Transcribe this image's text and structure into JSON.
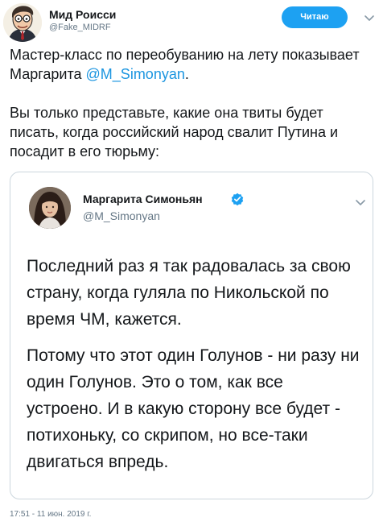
{
  "tweet": {
    "author": {
      "display_name": "Мид Роисси",
      "handle": "@Fake_MIDRF",
      "avatar_icon": "cartoon-avatar-icon"
    },
    "follow_button_label": "Читаю",
    "menu_icon": "chevron-down-icon",
    "text": {
      "paragraph1_prefix": "Мастер-класс по переобуванию на лету показывает Маргарита ",
      "mention": "@M_Simonyan",
      "paragraph1_suffix": ".",
      "paragraph2": "Вы только представьте, какие она твиты будет писать, когда российский народ свалит Путина и посадит в его тюрьму:"
    },
    "timestamp": "17:51 - 11 июн. 2019 г."
  },
  "quoted_tweet": {
    "author": {
      "display_name": "Маргарита Симоньян",
      "handle": "@M_Simonyan",
      "verified_icon": "verified-badge-icon",
      "avatar_icon": "profile-photo-icon"
    },
    "menu_icon": "chevron-down-icon",
    "paragraphs": [
      "Последний раз я так радовалась за свою страну, когда гуляла по Никольской по время ЧМ, кажется.",
      "Потому что этот один Голунов - ни разу ни один Голунов. Это о том, как все устроено. И в какую сторону все будет - потихоньку, со скрипом, но все-таки двигаться впредь."
    ]
  },
  "colors": {
    "accent": "#1da1f2",
    "mention": "#1b95e0",
    "text": "#14171a",
    "secondary": "#657786",
    "border": "#ccd6dd"
  }
}
